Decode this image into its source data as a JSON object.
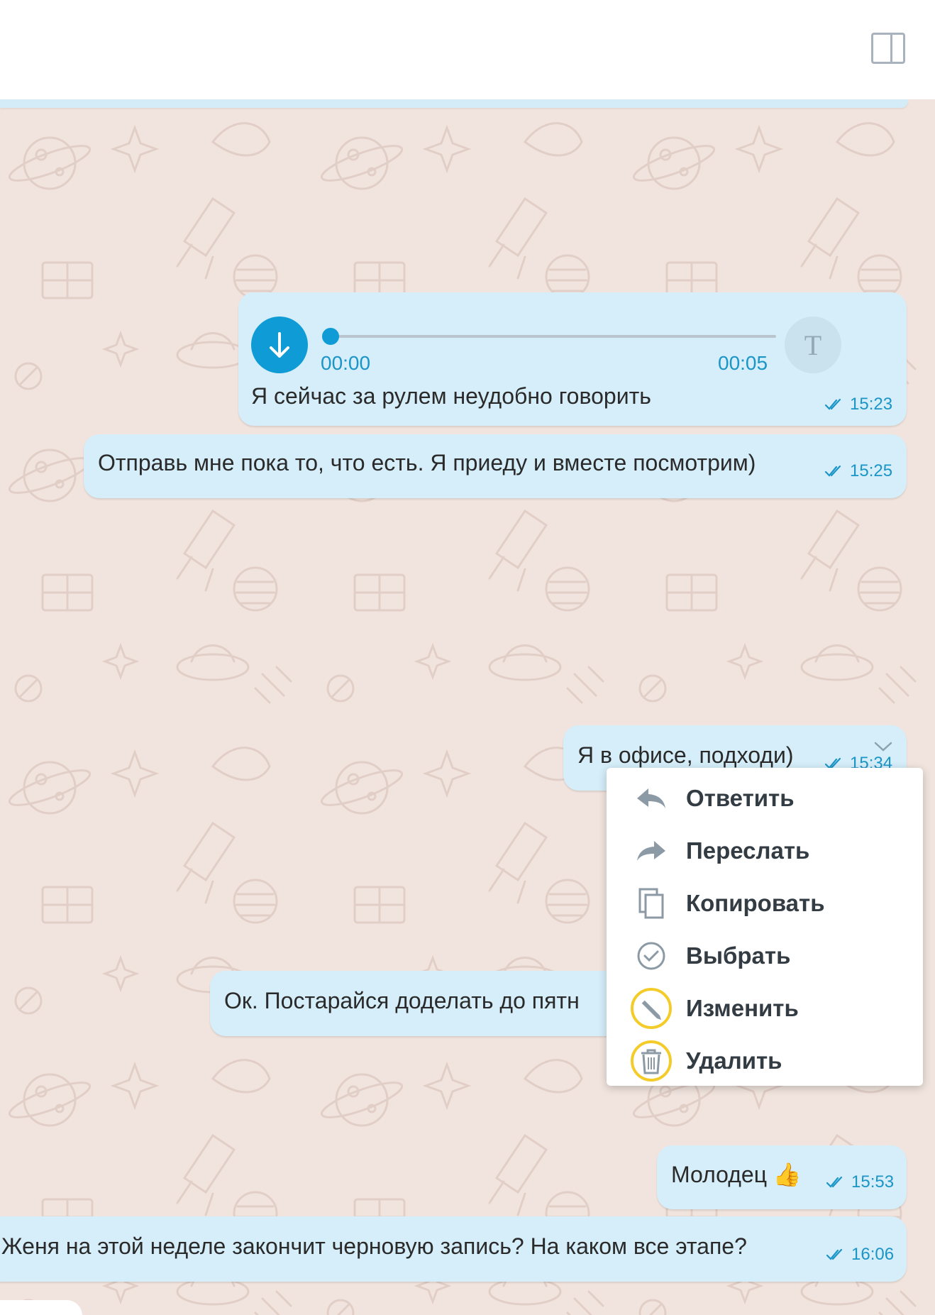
{
  "header": {
    "panel_toggle_icon": "side-panel-icon"
  },
  "messages": [
    {
      "type": "voice",
      "elapsed": "00:00",
      "duration": "00:05",
      "progress": 0,
      "transcribe_label": "T",
      "caption": "Я сейчас за рулем неудобно говорить",
      "time": "15:23",
      "status": "read"
    },
    {
      "type": "text",
      "text": "Отправь мне пока то, что есть. Я приеду и вместе посмотрим)",
      "time": "15:25",
      "status": "read"
    },
    {
      "type": "text",
      "text": "Я в офисе, подходи)",
      "time": "15:34",
      "status": "read",
      "selected": true
    },
    {
      "type": "text",
      "text": "Ок. Постарайся доделать до пятн",
      "time": "",
      "status": "read"
    },
    {
      "type": "text",
      "text": "Молодец 👍",
      "time": "15:53",
      "status": "read"
    },
    {
      "type": "text",
      "text": "Женя на этой неделе закончит черновую запись? На каком все этапе?",
      "time": "16:06",
      "status": "read"
    }
  ],
  "context_menu": {
    "items": [
      {
        "label": "Ответить",
        "icon": "reply-icon",
        "highlighted": false
      },
      {
        "label": "Переслать",
        "icon": "forward-icon",
        "highlighted": false
      },
      {
        "label": "Копировать",
        "icon": "copy-icon",
        "highlighted": false
      },
      {
        "label": "Выбрать",
        "icon": "select-check-icon",
        "highlighted": false
      },
      {
        "label": "Изменить",
        "icon": "pencil-icon",
        "highlighted": true
      },
      {
        "label": "Удалить",
        "icon": "trash-icon",
        "highlighted": true
      }
    ]
  },
  "colors": {
    "chat_background": "#f1e4de",
    "bubble": "#d5eef9",
    "accent": "#0e9bd6",
    "timestamp": "#1b95c7",
    "highlight_ring": "#f4cc2a"
  }
}
